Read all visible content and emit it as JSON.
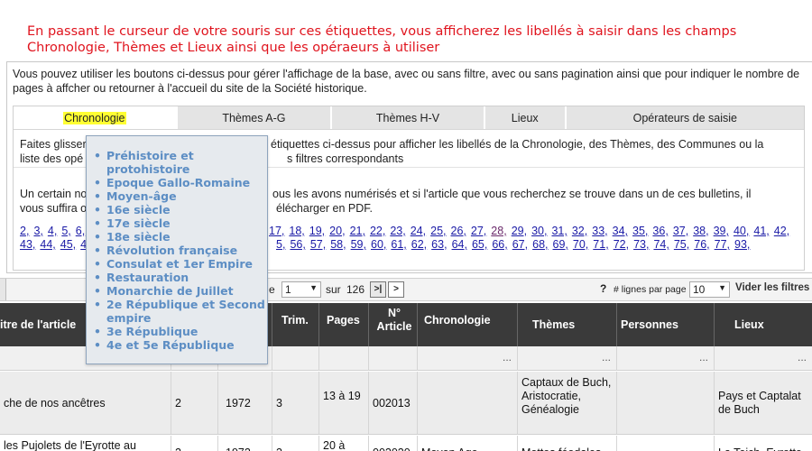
{
  "banner": "En passant le curseur de votre souris sur ces étiquettes, vous afficherez les libellés à saisir dans les champs Chronologie, Thèmes et Lieux ainsi que les opéraeurs à utiliser",
  "intro": "Vous pouvez utiliser les boutons ci-dessus pour gérer l'affichage de la base, avec ou sans filtre, avec ou sans pagination ainsi que pour indiquer le nombre de pages à affcher ou retourner à l'accueil du site de la Société historique.",
  "tabs": [
    "Chronologie",
    "Thèmes A-G",
    "Thèmes H-V",
    "Lieux",
    "Opérateurs de saisie"
  ],
  "info": {
    "line1_start": "Faites glisser",
    "line1_end": "étiquettes ci-dessus pour afficher les libellés de la Chronologie, des Thèmes, des Communes ou la",
    "line2_start": "liste des opé",
    "line2_end": "s filtres correspondants",
    "line3_start": "Un certain no",
    "line3_end": "ous les avons numérisés et si l'article que vous recherchez se trouve dans un de ces bulletins, il",
    "line4_start": "vous suffira o",
    "line4_end": "élécharger en PDF."
  },
  "links_row1_left": [
    "2,",
    "3,",
    "4,",
    "5,",
    "6,"
  ],
  "links_row1_right": [
    "17,",
    "18,",
    "19,",
    "20,",
    "21,",
    "22,",
    "23,",
    "24,",
    "25,",
    "26,",
    "27,",
    "28,",
    "29,",
    "30,",
    "31,",
    "32,",
    "33,",
    "34,",
    "35,",
    "36,",
    "37,",
    "38,",
    "39,",
    "40,",
    "41,",
    "42,"
  ],
  "links_row2_left": [
    "43,",
    "44,",
    "45,",
    "4"
  ],
  "links_row2_right": [
    "5,",
    "56,",
    "57,",
    "58,",
    "59,",
    "60,",
    "61,",
    "62,",
    "63,",
    "64,",
    "65,",
    "66,",
    "67,",
    "68,",
    "69,",
    "70,",
    "71,",
    "72,",
    "73,",
    "74,",
    "75,",
    "76,",
    "77,",
    "93,"
  ],
  "pager": {
    "page_label": "e",
    "page_value": "1",
    "sur": "sur",
    "total": "126",
    "next_last": ">|",
    "next": ">",
    "help": "?",
    "rows_label": "# lignes par page",
    "rows_value": "10",
    "filters": "Vider les filtres"
  },
  "columns": [
    "itre de l'article",
    "Trim.",
    "Pages",
    "N° Article",
    "Chronologie",
    "Thèmes",
    "Personnes",
    "Lieux"
  ],
  "filter_dots": "...",
  "rows": [
    {
      "title": "che de nos ancêtres",
      "vol": "2",
      "year": "1972",
      "trim": "3",
      "pages": "13 à 19",
      "num": "002013",
      "chrono": "",
      "themes": "Captaux de Buch, Aristocratie, Généalogie",
      "persons": "",
      "lieux": "Pays et Captalat de Buch"
    },
    {
      "title": "les Pujolets de l'Eyrotte au",
      "vol": "2",
      "year": "1972",
      "trim": "3",
      "pages": "20 à",
      "num": "002020",
      "chrono": "Moyen Age",
      "themes": "Mottes féodales",
      "persons": "",
      "lieux": "La Teich, Eyrotte"
    }
  ],
  "dropdown": [
    "Préhistoire et protohistoire",
    "Epoque Gallo-Romaine",
    "Moyen-âge",
    "16e siècle",
    "17e siècle",
    "18e siècle",
    "Révolution française",
    "Consulat et 1er Empire",
    "Restauration",
    "Monarchie de Juillet",
    "2e République et Second empire",
    "3e République",
    "4e et 5e République"
  ]
}
